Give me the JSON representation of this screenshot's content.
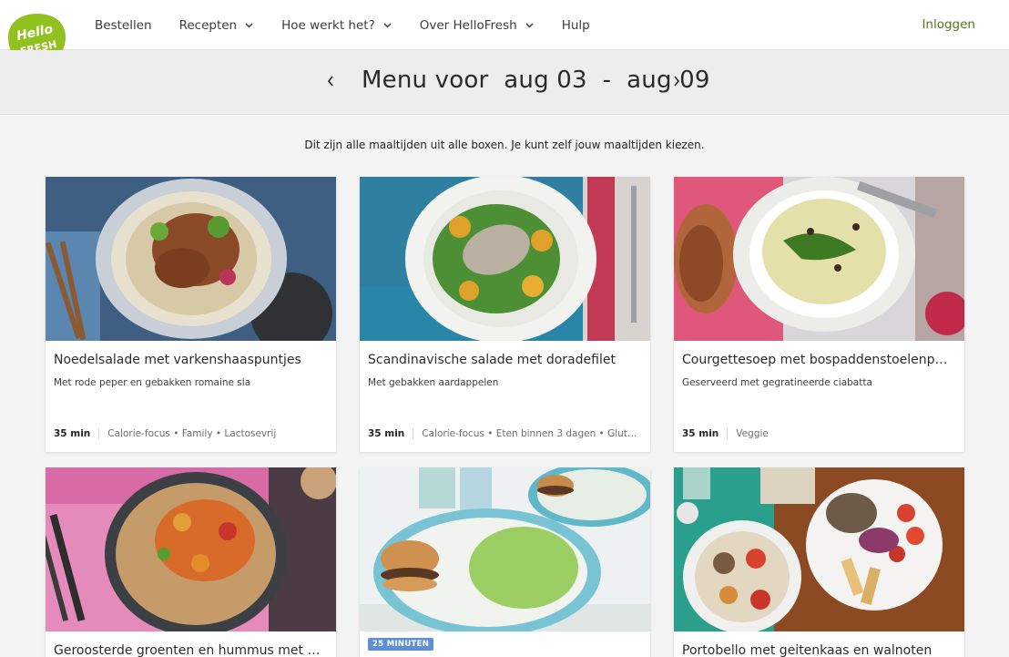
{
  "header": {
    "logo_text_1": "Hello",
    "logo_text_2": "FRESH",
    "nav": [
      {
        "label": "Bestellen",
        "dropdown": false
      },
      {
        "label": "Recepten",
        "dropdown": true
      },
      {
        "label": "Hoe werkt het?",
        "dropdown": true
      },
      {
        "label": "Over HelloFresh",
        "dropdown": true
      },
      {
        "label": "Hulp",
        "dropdown": false
      }
    ],
    "login_label": "Inloggen"
  },
  "week": {
    "title": "Menu voor  aug 03  -  aug 09",
    "prev_icon": "chevron-left-icon",
    "next_icon": "chevron-right-icon"
  },
  "intro": "Dit zijn alle maaltijden uit alle boxen. Je kunt zelf jouw maaltijden kiezen.",
  "recipes": [
    {
      "title": "Noedelsalade met varkenshaaspuntjes",
      "subtitle": "Met rode peper en gebakken romaine sla",
      "time": "35 min",
      "tags": "Calorie-focus • Family • Lactosevrij"
    },
    {
      "title": "Scandinavische salade met doradefilet",
      "subtitle": "Met gebakken aardappelen",
      "time": "35 min",
      "tags": "Calorie-focus • Eten binnen 3 dagen • Gluten…"
    },
    {
      "title": "Courgettesoep met bospaddenstoelenpe…",
      "subtitle": "Geserveerd met gegratineerde ciabatta",
      "time": "35 min",
      "tags": "Veggie"
    },
    {
      "title": "Geroosterde groenten en hummus met e…",
      "badge": ""
    },
    {
      "title": "",
      "badge": "25 MINUTEN"
    },
    {
      "title": "Portobello met geitenkaas en walnoten",
      "badge": ""
    }
  ],
  "colors": {
    "brand_green": "#91c11e",
    "login_green": "#4c7a19",
    "badge_blue": "#5e8fd6"
  }
}
